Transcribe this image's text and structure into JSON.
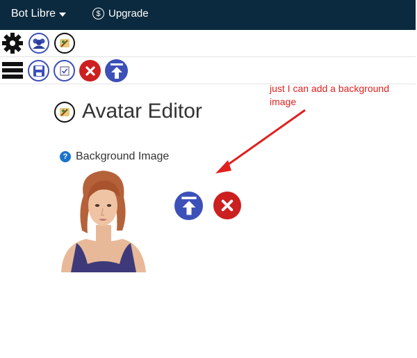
{
  "topbar": {
    "brand": "Bot Libre",
    "upgrade_label": "Upgrade",
    "background_color": "#0c2a3f"
  },
  "toolbar_row1": {
    "items": [
      {
        "icon": "gear-icon"
      },
      {
        "icon": "avatars-icon"
      },
      {
        "icon": "avatar-editor-icon"
      }
    ]
  },
  "toolbar_row2": {
    "items": [
      {
        "icon": "menu-icon"
      },
      {
        "icon": "save-icon"
      },
      {
        "icon": "checkbox-icon"
      },
      {
        "icon": "close-icon"
      },
      {
        "icon": "upload-icon"
      }
    ]
  },
  "page": {
    "title": "Avatar Editor",
    "help_symbol": "?",
    "background_label": "Background Image"
  },
  "actions": {
    "upload_icon": "upload-icon",
    "delete_icon": "close-icon"
  },
  "annotation": {
    "text": "just  I can add a background image",
    "color": "#e02020"
  },
  "colors": {
    "accent_blue": "#3c50b8",
    "danger_red": "#cc1f1f"
  }
}
